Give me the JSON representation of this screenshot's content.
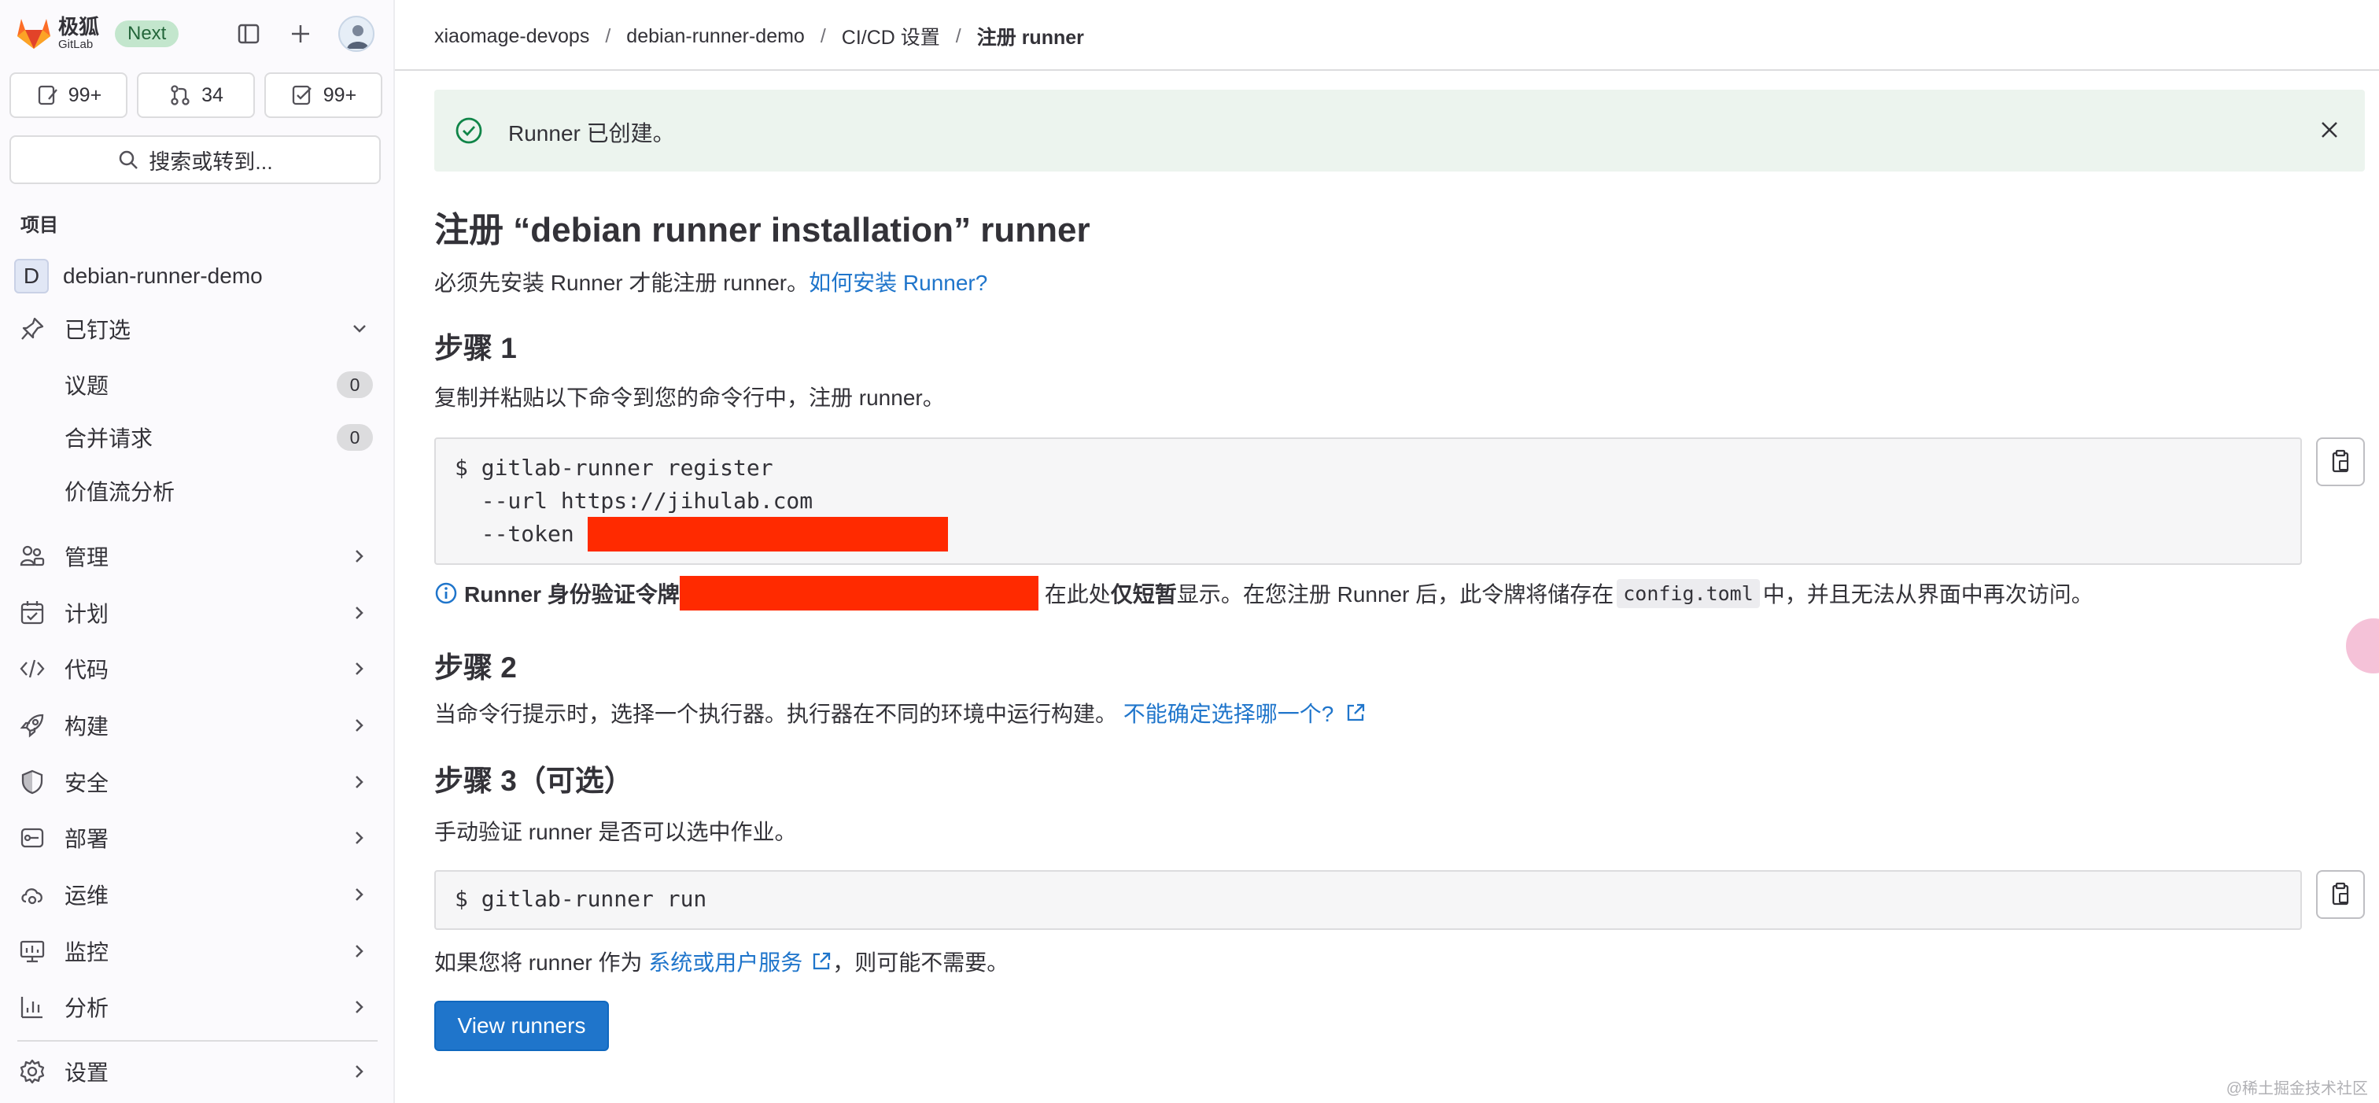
{
  "brand": {
    "logo_cn": "极狐",
    "logo_en": "GitLab",
    "badge": "Next"
  },
  "counters": [
    {
      "icon": "issues-icon",
      "value": "99+"
    },
    {
      "icon": "merge-request-icon",
      "value": "34"
    },
    {
      "icon": "todo-icon",
      "value": "99+"
    }
  ],
  "search": {
    "label": "搜索或转到..."
  },
  "sidebar": {
    "section_label": "项目",
    "project": {
      "initial": "D",
      "name": "debian-runner-demo"
    },
    "pinned": {
      "label": "已钉选",
      "items": [
        {
          "label": "议题",
          "count": "0"
        },
        {
          "label": "合并请求",
          "count": "0"
        },
        {
          "label": "价值流分析"
        }
      ]
    },
    "items": [
      {
        "label": "管理",
        "icon": "users-icon"
      },
      {
        "label": "计划",
        "icon": "calendar-icon"
      },
      {
        "label": "代码",
        "icon": "code-icon"
      },
      {
        "label": "构建",
        "icon": "rocket-icon"
      },
      {
        "label": "安全",
        "icon": "shield-icon"
      },
      {
        "label": "部署",
        "icon": "deploy-icon"
      },
      {
        "label": "运维",
        "icon": "cloud-gear-icon"
      },
      {
        "label": "监控",
        "icon": "monitor-icon"
      },
      {
        "label": "分析",
        "icon": "chart-icon"
      }
    ],
    "settings": {
      "label": "设置",
      "icon": "gear-icon"
    }
  },
  "breadcrumb": [
    "xiaomage-devops",
    "debian-runner-demo",
    "CI/CD 设置",
    "注册 runner"
  ],
  "alert": {
    "text": "Runner 已创建。"
  },
  "page": {
    "title": "注册 “debian runner installation” runner",
    "intro": "必须先安装 Runner 才能注册 runner。",
    "intro_link": "如何安装 Runner?"
  },
  "step1": {
    "title": "步骤 1",
    "desc": "复制并粘贴以下命令到您的命令行中，注册 runner。",
    "code": [
      "$ gitlab-runner register",
      "  --url https://jihulab.com",
      "  --token "
    ],
    "info_bold": "Runner 身份验证令牌",
    "info_mid": "在此处",
    "info_bold2": "仅短暂",
    "info_after": "显示。在您注册 Runner 后，此令牌将储存在",
    "info_code": "config.toml",
    "info_end": "中，并且无法从界面中再次访问。"
  },
  "step2": {
    "title": "步骤 2",
    "desc": "当命令行提示时，选择一个执行器。执行器在不同的环境中运行构建。",
    "link": "不能确定选择哪一个?"
  },
  "step3": {
    "title": "步骤 3（可选）",
    "desc": "手动验证 runner 是否可以选中作业。",
    "code": "$ gitlab-runner run",
    "note_before": "如果您将 runner 作为",
    "note_link": "系统或用户服务",
    "note_after": "，则可能不需要。"
  },
  "button": {
    "view_runners": "View runners"
  },
  "watermark": "@稀土掘金技术社区",
  "colors": {
    "accent": "#1f75cb",
    "success_bg": "#ecf4ee",
    "success_icon": "#108548",
    "redaction": "#ff2a00",
    "badge_bg": "#c3e6cd"
  }
}
